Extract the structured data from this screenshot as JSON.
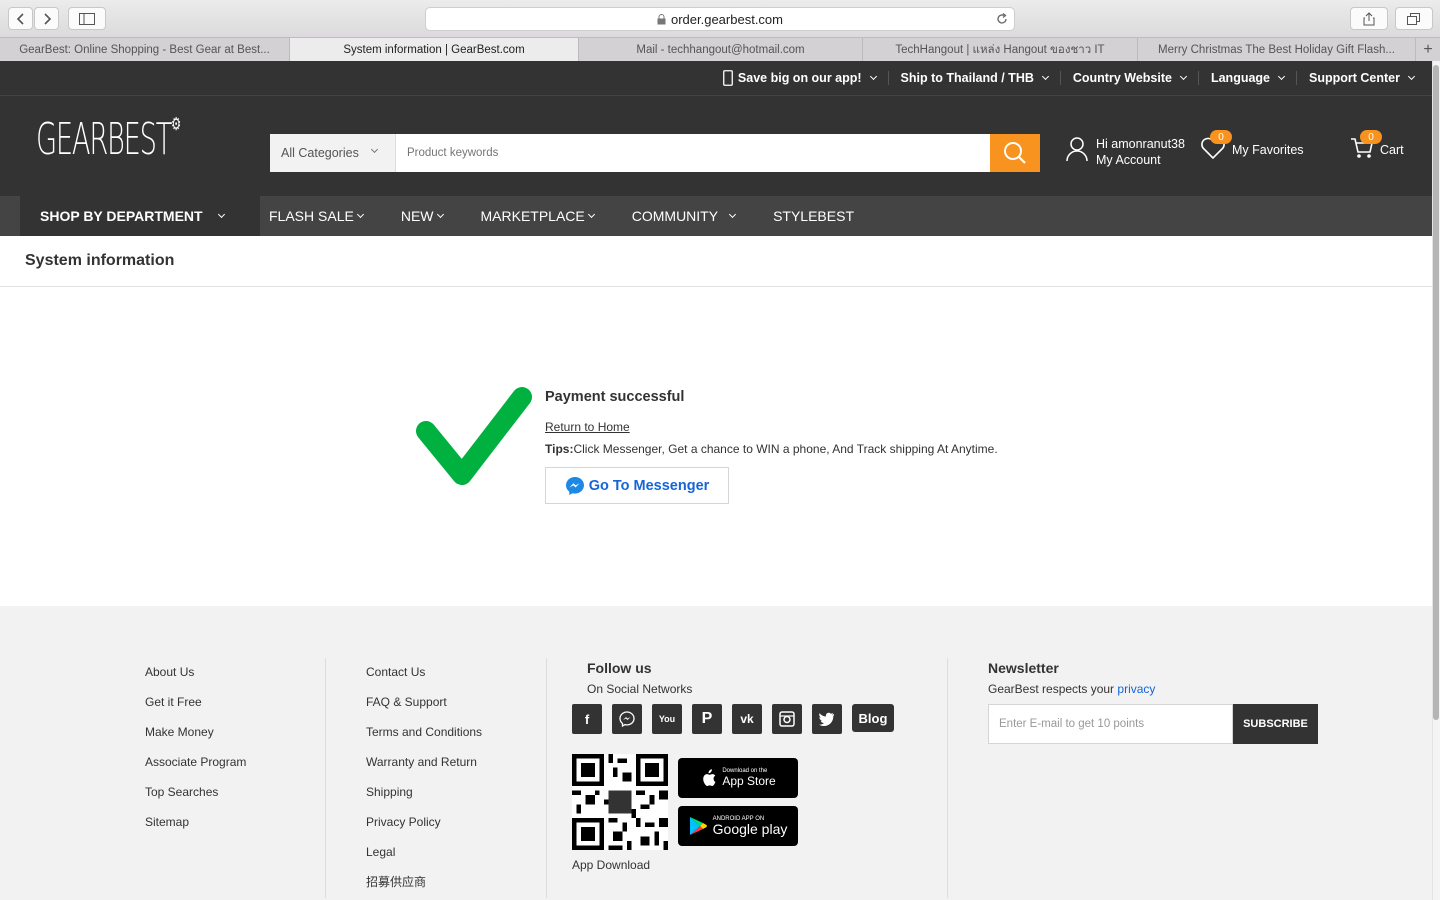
{
  "browser": {
    "url": "order.gearbest.com",
    "tabs": [
      {
        "label": "GearBest: Online Shopping - Best Gear at Best..."
      },
      {
        "label": "System information | GearBest.com"
      },
      {
        "label": "Mail - techhangout@hotmail.com"
      },
      {
        "label": "TechHangout | แหล่ง Hangout ของชาว IT"
      },
      {
        "label": "Merry Christmas The Best Holiday Gift Flash..."
      }
    ]
  },
  "topbar": {
    "app": "Save big on our app!",
    "ship": "Ship to Thailand / THB",
    "country": "Country Website",
    "language": "Language",
    "support": "Support Center"
  },
  "header": {
    "logo": "GEARBEST",
    "category": "All Categories",
    "search_placeholder": "Product keywords",
    "greeting": "Hi amonranut38",
    "account": "My Account",
    "favorites": "My Favorites",
    "favorites_count": "0",
    "cart": "Cart",
    "cart_count": "0"
  },
  "nav": {
    "department": "SHOP BY DEPARTMENT",
    "items": [
      "FLASH SALE",
      "NEW",
      "MARKETPLACE",
      "COMMUNITY",
      "STYLEBEST"
    ]
  },
  "page": {
    "title": "System information",
    "status": "Payment successful",
    "return_link": "Return to Home",
    "tips_label": "Tips:",
    "tips_text": "Click Messenger, Get a chance to WIN a phone, And Track shipping At Anytime.",
    "messenger_button": "Go To Messenger"
  },
  "footer": {
    "col1": [
      "About Us",
      "Get it Free",
      "Make Money",
      "Associate Program",
      "Top Searches",
      "Sitemap"
    ],
    "col2": [
      "Contact Us",
      "FAQ & Support",
      "Terms and Conditions",
      "Warranty and Return",
      "Shipping",
      "Privacy Policy",
      "Legal",
      "招募供应商"
    ],
    "follow_title": "Follow us",
    "follow_sub": "On Social Networks",
    "social": [
      "facebook-icon",
      "messenger-icon",
      "youtube-icon",
      "pinterest-icon",
      "vk-icon",
      "instagram-icon",
      "twitter-icon",
      "blog-icon"
    ],
    "blog_label": "Blog",
    "app_store_small": "Download on the",
    "app_store_big": "App Store",
    "google_small": "ANDROID APP ON",
    "google_big": "Google play",
    "app_download": "App Download",
    "newsletter_title": "Newsletter",
    "newsletter_text": "GearBest respects your",
    "privacy_link": "privacy",
    "email_placeholder": "Enter E-mail to get 10 points",
    "subscribe": "SUBSCRIBE"
  },
  "colors": {
    "accent": "#f7931e",
    "dark": "#333333",
    "success": "#00b140",
    "messenger": "#1565d8"
  }
}
